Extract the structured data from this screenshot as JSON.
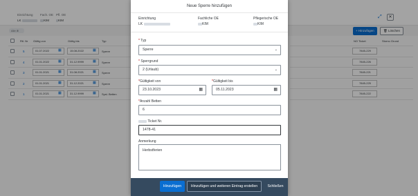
{
  "background": {
    "header_fields": [
      {
        "label": "Einrichtung",
        "value": "LK"
      },
      {
        "label": "Fach. OE",
        "value": "KIM"
      },
      {
        "label": "Pfl. OE",
        "value": "KIM"
      }
    ],
    "filter_chip": "Alle",
    "toolbar": {
      "add_label": "+ Hinzufügen",
      "delete_label": "Löschen"
    },
    "columns": {
      "nr": "Rtl. Nr",
      "from": "Gültig von",
      "to": "Gültig bis",
      "type": "Typ",
      "ticket": "NO Ticket",
      "reason": "Storno Grund"
    },
    "rows": [
      {
        "nr": "5",
        "from": "01.07.2022",
        "to": "15.08.2022",
        "type": "Sperre",
        "ticket": "7845-229"
      },
      {
        "nr": "4",
        "from": "01.01.2022",
        "to": "31.12.9999",
        "type": "Sperre",
        "ticket": "7845-226"
      },
      {
        "nr": "3",
        "from": "01.01.2021",
        "to": "31.08.2021",
        "type": "Sperre",
        "ticket": "7845-221"
      },
      {
        "nr": "2",
        "from": "01.01.2021",
        "to": "31.12.2021",
        "type": "Sperre",
        "ticket": "7845-225"
      },
      {
        "nr": "1",
        "from": "01.01.2021",
        "to": "31.12.9999",
        "type": "Syst. Betten",
        "ticket": "7845-222"
      }
    ]
  },
  "dialog": {
    "title": "Neue Sperre hinzufügen",
    "info": {
      "einrichtung_label": "Einrichtung",
      "einrichtung_value": "LK",
      "fach_label": "Fachliche OE",
      "fach_value": "KIM",
      "pflege_label": "Pflegerische OE",
      "pflege_value": "KIM"
    },
    "typ": {
      "label": "Typ",
      "value": "Sperre"
    },
    "sperrgrund": {
      "label": "Sperrgrund",
      "value": "2 (Urlaub)"
    },
    "gueltig_von": {
      "label": "Gültigkeit von",
      "value": "23.10.2023"
    },
    "gueltig_bis": {
      "label": "Gültigkeit bis",
      "value": "05.11.2023"
    },
    "anzahl": {
      "label": "Anzahl Betten",
      "value": "6"
    },
    "ticket": {
      "label": "Ticket Nr.",
      "value": "1478-41"
    },
    "anmerkung": {
      "label": "Anmerkung",
      "value": "Herbstferien"
    },
    "buttons": {
      "add": "Hinzufügen",
      "add_more": "Hinzufügen und weiteren Eintrag erstellen",
      "close": "Schließen"
    }
  },
  "colors": {
    "accent": "#0a6ed1",
    "footer": "#354a5f",
    "required": "#bb0000"
  }
}
